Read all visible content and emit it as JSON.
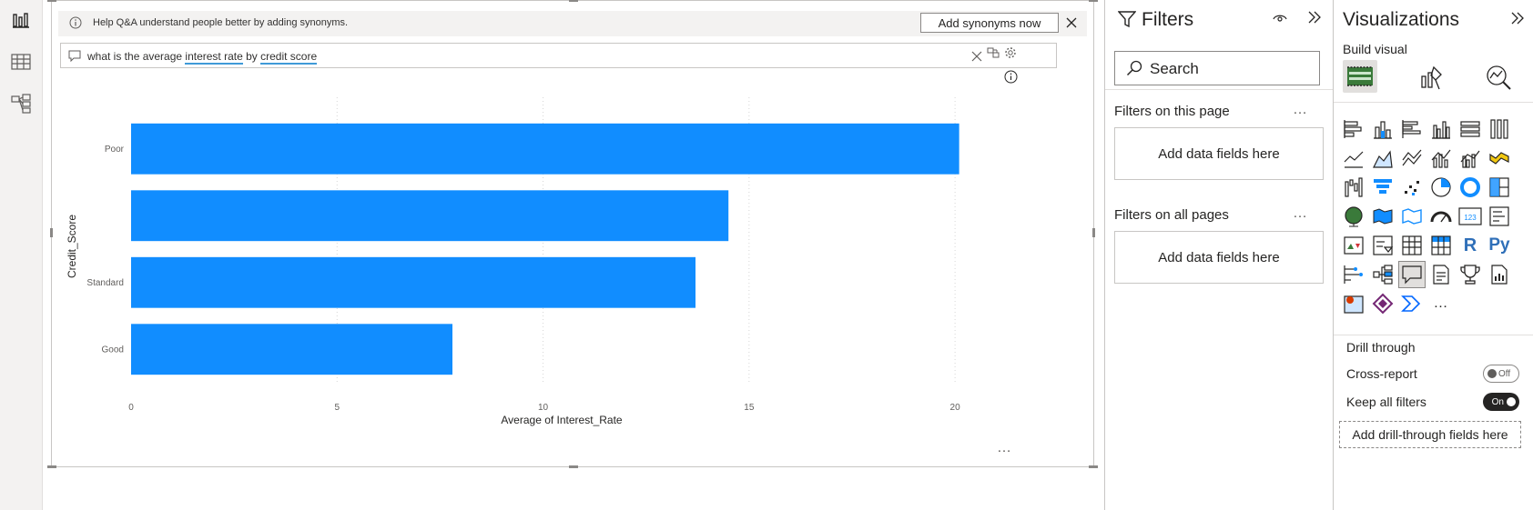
{
  "leftnav": {
    "items": [
      {
        "name": "report-view",
        "icon": "bar-chart-icon"
      },
      {
        "name": "table-view",
        "icon": "table-icon"
      },
      {
        "name": "model-view",
        "icon": "model-icon"
      }
    ]
  },
  "banner": {
    "text": "Help Q&A understand people better by adding synonyms.",
    "button_label": "Add synonyms now",
    "icon": "info-icon"
  },
  "qna": {
    "prefix": "what is the average ",
    "term1": "interest rate",
    "middle": " by ",
    "term2": "credit score"
  },
  "chart_data": {
    "type": "bar",
    "orientation": "horizontal",
    "categories": [
      "Poor",
      "",
      "Standard",
      "Good"
    ],
    "values": [
      20.1,
      14.5,
      13.7,
      7.8
    ],
    "xlabel": "Average of Interest_Rate",
    "ylabel": "Credit_Score",
    "xlim": [
      0,
      21.5
    ],
    "xticks": [
      0,
      5,
      10,
      15,
      20
    ],
    "grid": true,
    "bar_color": "#118dff"
  },
  "filters": {
    "title": "Filters",
    "search_placeholder": "Search",
    "this_page": {
      "label": "Filters on this page",
      "dropzone": "Add data fields here"
    },
    "all_pages": {
      "label": "Filters on all pages",
      "dropzone": "Add data fields here"
    },
    "more": "…"
  },
  "visualizations": {
    "title": "Visualizations",
    "build_visual": "Build visual",
    "more": "…",
    "drill_through": {
      "title": "Drill through",
      "cross_report": {
        "label": "Cross-report",
        "state": "Off"
      },
      "keep_all_filters": {
        "label": "Keep all filters",
        "state": "On"
      },
      "add_fields": "Add drill-through fields here"
    },
    "r_label": "R",
    "py_label": "Py",
    "kpi_label": "123"
  },
  "colors": {
    "accent": "#118dff",
    "pane_bg": "#f3f2f1",
    "text": "#252423"
  },
  "canvas_more": "…"
}
